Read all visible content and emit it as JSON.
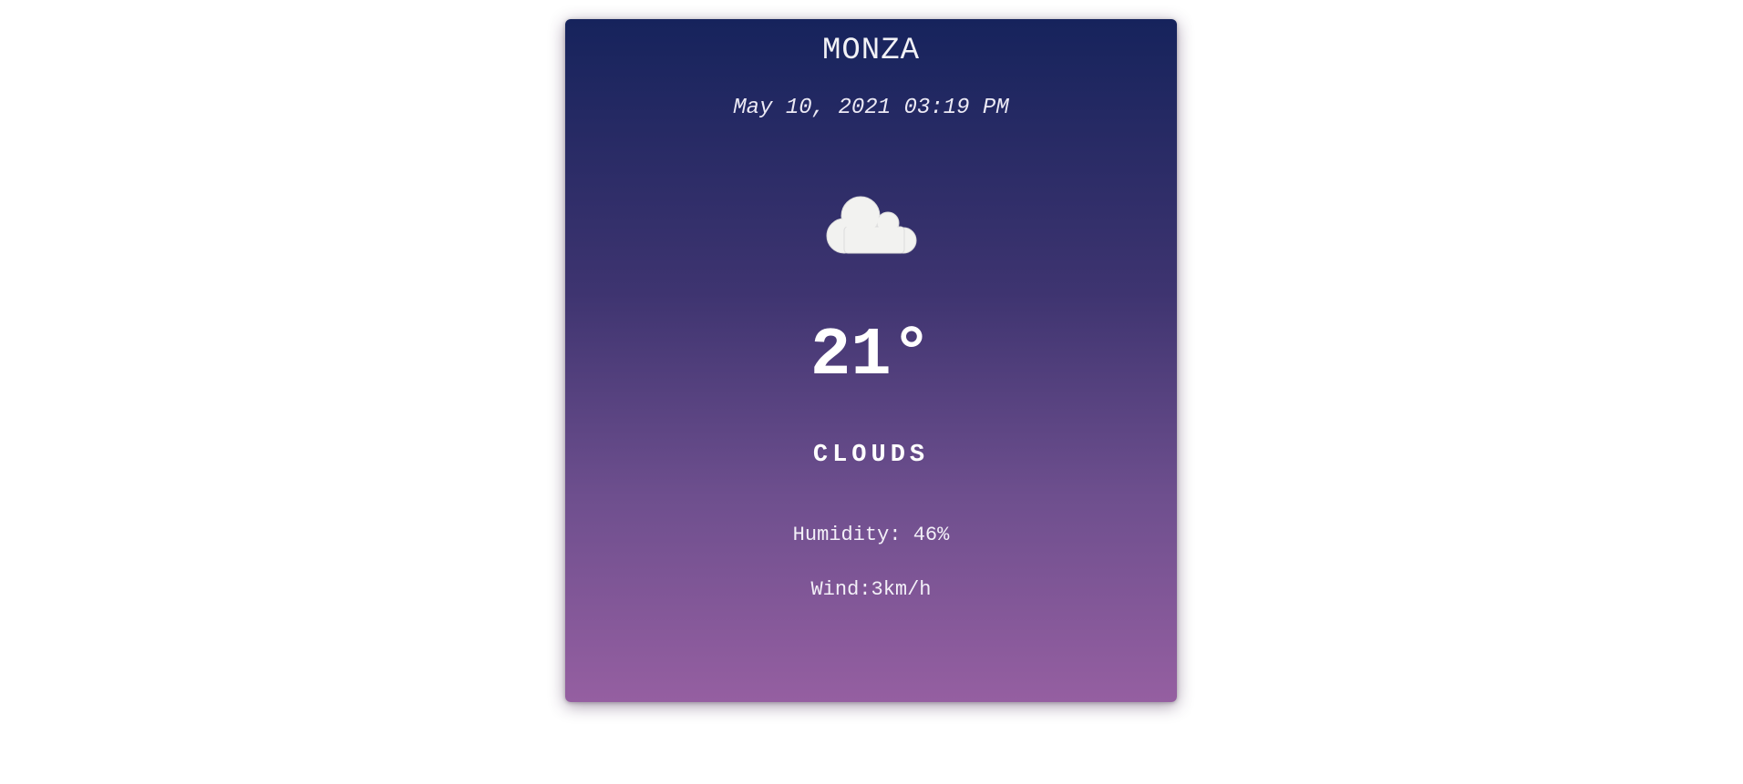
{
  "weather": {
    "city": "MONZA",
    "datetime": "May 10, 2021 03:19 PM",
    "icon": "cloud-icon",
    "temperature": "21°",
    "condition": "CLOUDS",
    "humidity": "Humidity: 46%",
    "wind": "Wind:3km/h"
  },
  "colors": {
    "gradient_top": "#16235c",
    "gradient_bottom": "#955fa1",
    "icon_fill": "#f2f2f0",
    "text": "#ffffff"
  }
}
